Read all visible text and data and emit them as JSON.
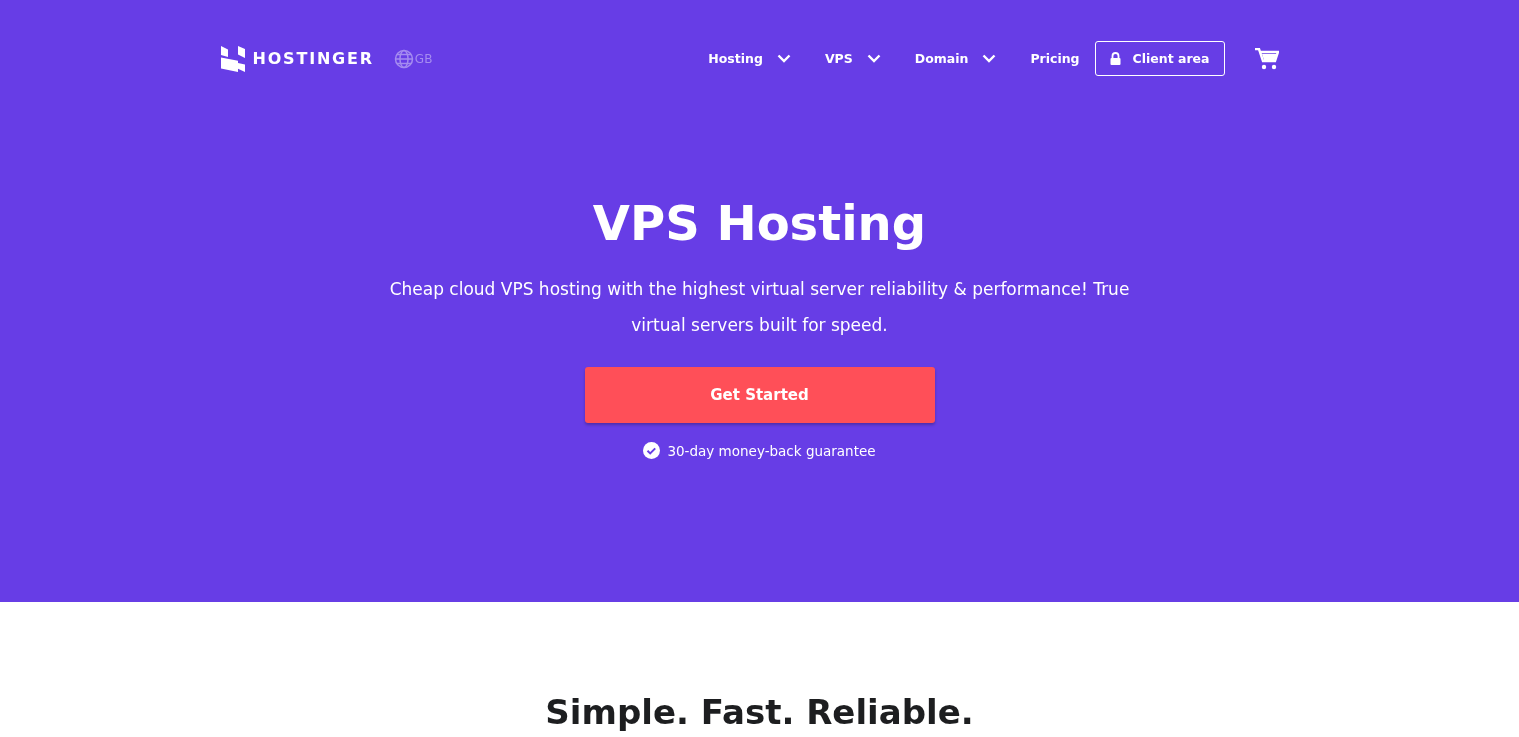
{
  "header": {
    "logo_text": "HOSTINGER",
    "region": "GB",
    "nav": [
      {
        "label": "Hosting",
        "kind": "dropdown"
      },
      {
        "label": "VPS",
        "kind": "dropdown"
      },
      {
        "label": "Domain",
        "kind": "dropdown"
      },
      {
        "label": "Pricing",
        "kind": "link"
      },
      {
        "label": "Client area",
        "kind": "button"
      }
    ]
  },
  "hero": {
    "title": "VPS Hosting",
    "subtitle": "Cheap cloud VPS hosting with the highest virtual server reliability & performance! True virtual servers built for speed.",
    "button": "Get Started",
    "guarantee": "30-day money-back guarantee"
  },
  "section": {
    "heading": "Simple. Fast. Reliable."
  }
}
